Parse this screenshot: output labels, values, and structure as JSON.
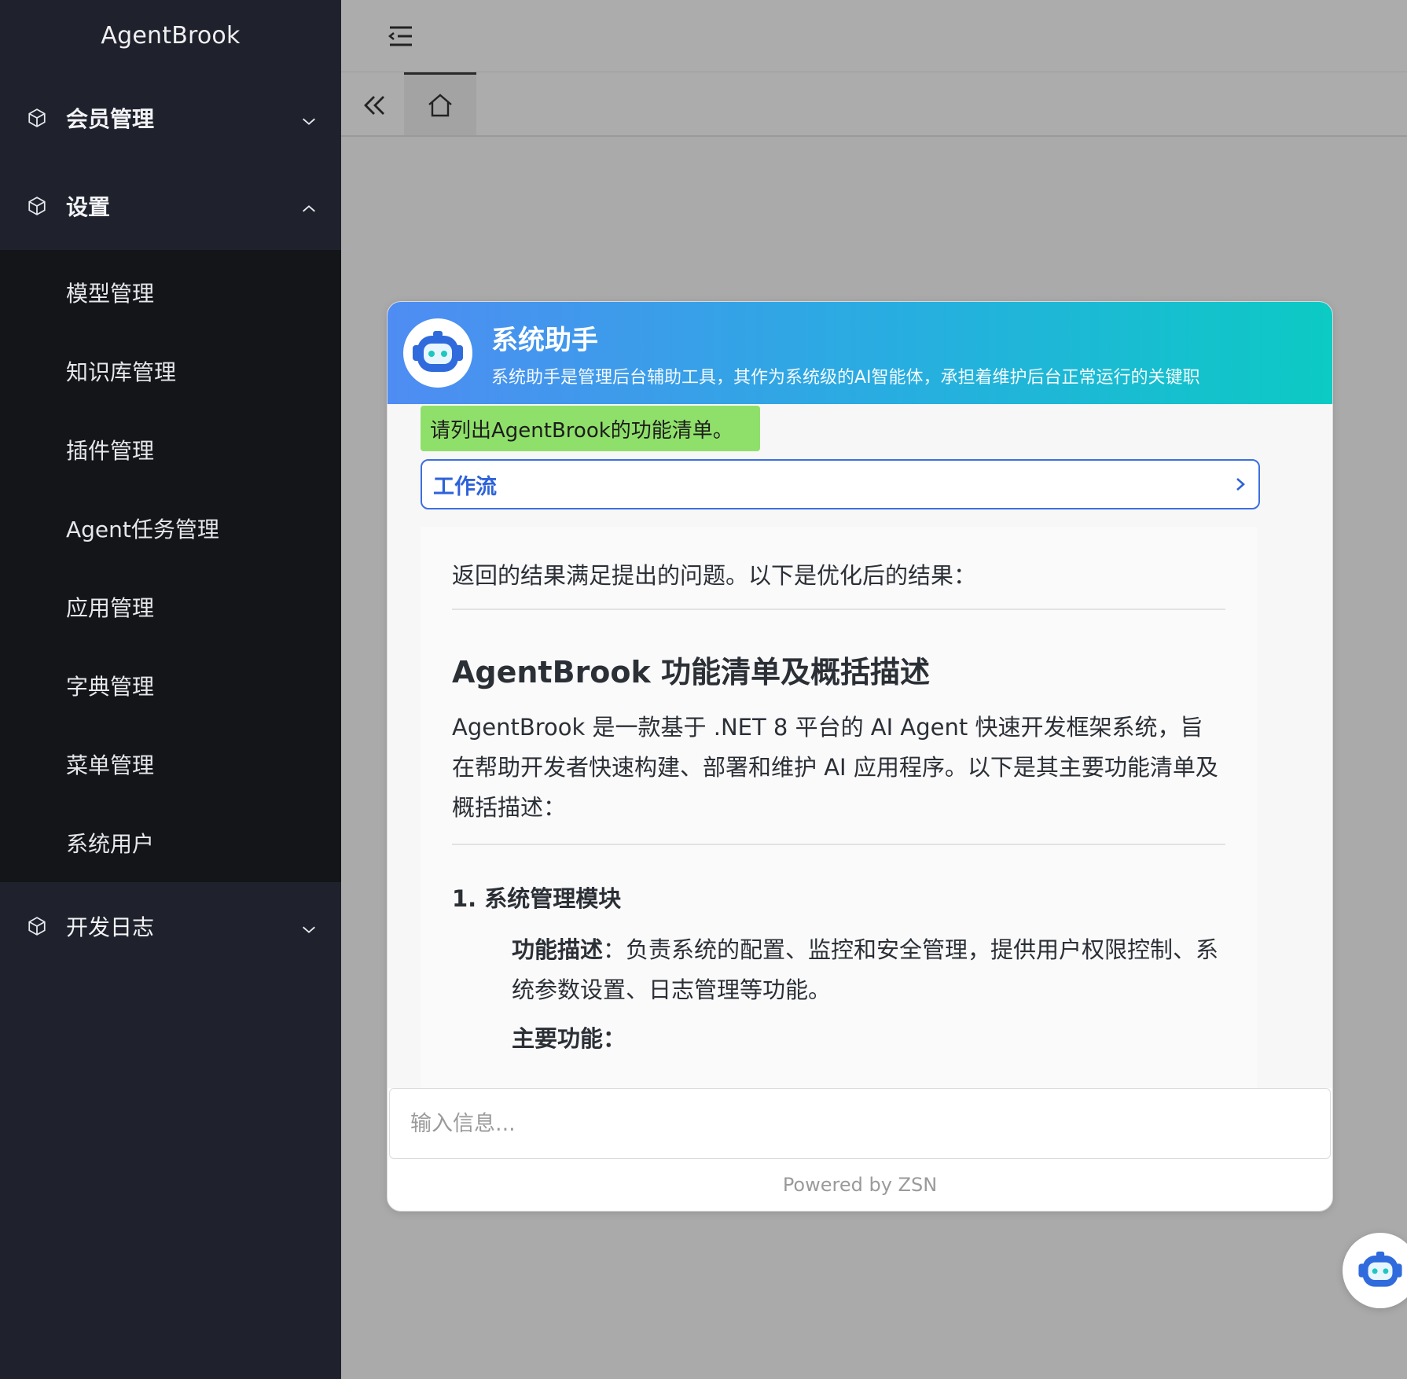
{
  "app": {
    "brand": "AgentBrook"
  },
  "sidebar": {
    "groups": [
      {
        "label": "会员管理",
        "icon": "cube-icon",
        "expanded": false
      },
      {
        "label": "设置",
        "icon": "cube-icon",
        "expanded": true,
        "items": [
          "模型管理",
          "知识库管理",
          "插件管理",
          "Agent任务管理",
          "应用管理",
          "字典管理",
          "菜单管理",
          "系统用户"
        ]
      },
      {
        "label": "开发日志",
        "icon": "cube-icon",
        "expanded": false
      }
    ]
  },
  "tabs": {
    "home_icon": "home-icon",
    "back_icon": "double-chevron-left-icon"
  },
  "chat": {
    "title": "系统助手",
    "description": "系统助手是管理后台辅助工具，其作为系统级的AI智能体，承担着维护后台正常运行的关键职",
    "user_message": "请列出AgentBrook的功能清单。",
    "workflow_label": "工作流",
    "answer": {
      "intro": "返回的结果满足提出的问题。以下是优化后的结果：",
      "heading": "AgentBrook 功能清单及概括描述",
      "body": "AgentBrook 是一款基于 .NET 8 平台的 AI Agent 快速开发框架系统，旨在帮助开发者快速构建、部署和维护 AI 应用程序。以下是其主要功能清单及概括描述：",
      "section1_title": "1. 系统管理模块",
      "func_desc_label": "功能描述",
      "func_desc_text": "：负责系统的配置、监控和安全管理，提供用户权限控制、系统参数设置、日志管理等功能。",
      "main_func_label": "主要功能："
    },
    "input_placeholder": "输入信息...",
    "footer": "Powered by ZSN"
  },
  "colors": {
    "sidebar_bg": "#1f212c",
    "submenu_bg": "#141519",
    "accent": "#2e62d9",
    "user_bubble": "#8fe06a"
  }
}
